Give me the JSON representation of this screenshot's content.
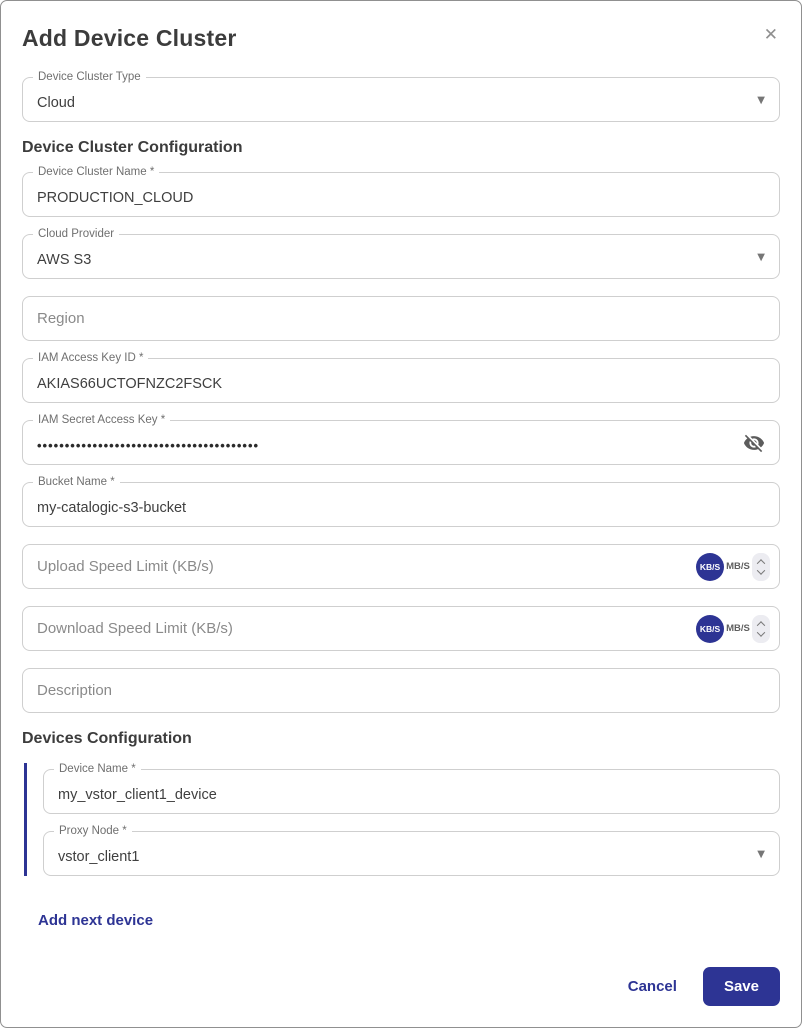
{
  "modal": {
    "title": "Add Device Cluster"
  },
  "icons": {
    "close": "✕",
    "dropdown": "▼"
  },
  "sections": {
    "cluster": "Device Cluster Configuration",
    "devices": "Devices Configuration"
  },
  "fields": {
    "device_cluster_type": {
      "label": "Device Cluster Type",
      "value": "Cloud"
    },
    "device_cluster_name": {
      "label": "Device Cluster Name *",
      "value": "PRODUCTION_CLOUD"
    },
    "cloud_provider": {
      "label": "Cloud Provider",
      "value": "AWS S3"
    },
    "region": {
      "placeholder": "Region"
    },
    "iam_access_key_id": {
      "label": "IAM Access Key ID *",
      "value": "AKIAS66UCTOFNZC2FSCK"
    },
    "iam_secret_access_key": {
      "label": "IAM Secret Access Key *",
      "masked_value": "••••••••••••••••••••••••••••••••••••••••"
    },
    "bucket_name": {
      "label": "Bucket Name *",
      "value": "my-catalogic-s3-bucket"
    },
    "upload_speed_limit": {
      "placeholder": "Upload Speed Limit (KB/s)",
      "unit_selected": "KB/S",
      "unit_alternate": "MB/S"
    },
    "download_speed_limit": {
      "placeholder": "Download Speed Limit (KB/s)",
      "unit_selected": "KB/S",
      "unit_alternate": "MB/S"
    },
    "description": {
      "placeholder": "Description"
    },
    "device_name": {
      "label": "Device Name *",
      "value": "my_vstor_client1_device"
    },
    "proxy_node": {
      "label": "Proxy Node *",
      "value": "vstor_client1"
    }
  },
  "actions": {
    "add_next_device": "Add next device",
    "cancel": "Cancel",
    "save": "Save"
  },
  "colors": {
    "accent": "#2d3494",
    "field_border": "#cfcfcf",
    "label_gray": "#6f6f6f",
    "placeholder_gray": "#8a8a8a",
    "text_dark": "#3c3c3c"
  }
}
